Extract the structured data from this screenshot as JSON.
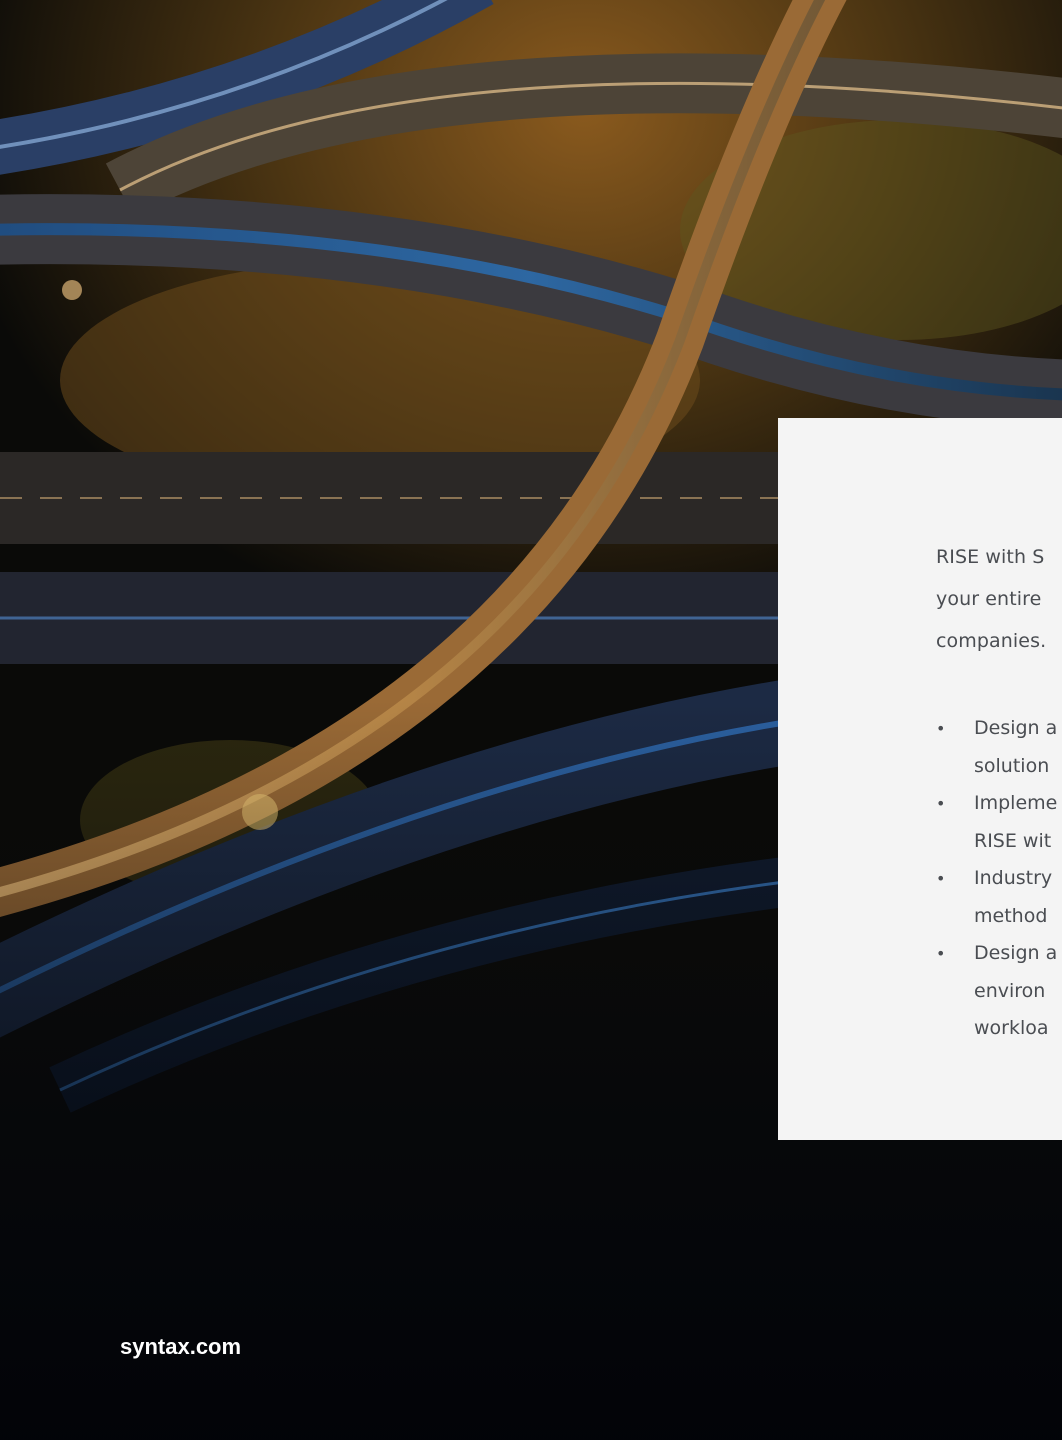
{
  "card": {
    "intro_lines": [
      "RISE with S",
      "your entire",
      "companies."
    ],
    "bullets": [
      {
        "lines": [
          "Design a",
          "solution"
        ]
      },
      {
        "lines": [
          "Impleme",
          "RISE wit"
        ]
      },
      {
        "lines": [
          "Industry",
          "method"
        ]
      },
      {
        "lines": [
          "Design a",
          "environ",
          "workloa"
        ]
      }
    ]
  },
  "footer": {
    "link_text": "syntax.com"
  },
  "colors": {
    "card_bg": "#f4f4f4",
    "body_text": "#4a4d52",
    "footer_text": "#ffffff"
  }
}
